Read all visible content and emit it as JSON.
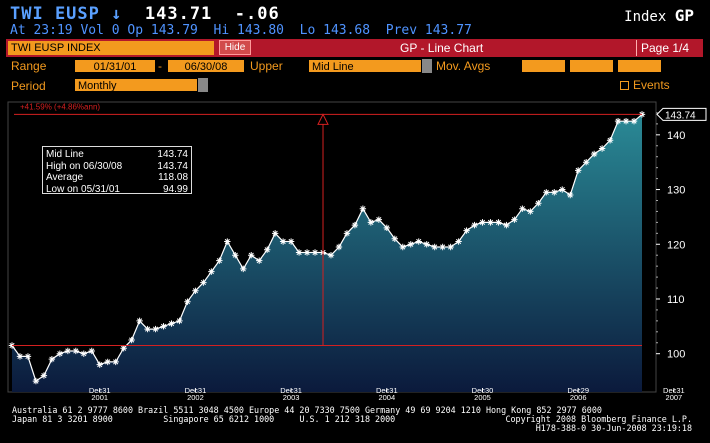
{
  "header": {
    "ticker": "TWI EUSP",
    "arrow": "↓",
    "price": "143.71",
    "change": "-.06",
    "market": "Index",
    "function": "GP",
    "at": "At 23:19",
    "vol": "Vol 0",
    "op": "Op 143.79",
    "hi": "Hi 143.80",
    "lo": "Lo 143.68",
    "prev": "Prev 143.77"
  },
  "toolbar": {
    "security": "TWI EUSP INDEX",
    "hide_label": "Hide",
    "title": "GP - Line Chart",
    "page": "Page 1/4"
  },
  "controls": {
    "range_label": "Range",
    "start_date": "01/31/01",
    "dash": "-",
    "end_date": "06/30/08",
    "upper_label": "Upper",
    "upper_value": "Mid Line",
    "mov_avgs_label": "Mov. Avgs",
    "period_label": "Period",
    "period_value": "Monthly",
    "events_label": "Events"
  },
  "chart_data": {
    "type": "area",
    "series": [
      {
        "name": "Mid Line",
        "values": [
          101.5,
          99.5,
          99.5,
          94.99,
          96,
          99,
          100,
          100.5,
          100.5,
          100,
          100.5,
          98,
          98.5,
          98.5,
          101,
          102.5,
          106,
          104.5,
          104.5,
          105,
          105.5,
          106,
          109.5,
          111.5,
          113,
          115,
          117,
          120.5,
          118,
          115.5,
          118,
          117,
          119,
          122,
          120.5,
          120.5,
          118.5,
          118.5,
          118.5,
          118.5,
          118,
          119.5,
          122,
          123.5,
          126.5,
          124,
          124.5,
          123,
          121,
          119.5,
          120,
          120.5,
          120,
          119.5,
          119.5,
          119.5,
          120.5,
          122.5,
          123.5,
          124,
          124,
          124,
          123.5,
          124.5,
          126.5,
          126,
          127.5,
          129.5,
          129.5,
          130,
          129,
          133.5,
          135,
          136.5,
          137.5,
          139,
          142.5,
          142.5,
          142.5,
          143.74
        ]
      }
    ],
    "x_ticks": [
      {
        "date": "Dec31",
        "year": "2001",
        "i": 11
      },
      {
        "date": "Dec31",
        "year": "2002",
        "i": 23
      },
      {
        "date": "Dec31",
        "year": "2003",
        "i": 35
      },
      {
        "date": "Dec31",
        "year": "2004",
        "i": 47
      },
      {
        "date": "Dec30",
        "year": "2005",
        "i": 59
      },
      {
        "date": "Dec29",
        "year": "2006",
        "i": 71
      },
      {
        "date": "Dec31",
        "year": "2007",
        "i": 83
      }
    ],
    "y_ticks": [
      100,
      110,
      120,
      130,
      140
    ],
    "ylim": [
      93,
      146
    ],
    "last_value_label": "143.74",
    "low_line": 101.5,
    "high_line": 143.74,
    "change_label": "+41.59% (+4.86%ann)",
    "legend": [
      {
        "label": "Mid Line",
        "value": "143.74"
      },
      {
        "label": "High on 06/30/08",
        "value": "143.74"
      },
      {
        "label": "Average",
        "value": "118.08"
      },
      {
        "label": "Low on 05/31/01",
        "value": "94.99"
      }
    ]
  },
  "footer": {
    "line1": "Australia 61 2 9777 8600 Brazil 5511 3048 4500 Europe 44 20 7330 7500 Germany 49 69 9204 1210 Hong Kong 852 2977 6000",
    "line2_left": "Japan 81 3 3201 8900",
    "line2_mid": "Singapore 65 6212 1000",
    "line2_mid2": "U.S. 1 212 318 2000",
    "line2_right": "Copyright 2008 Bloomberg Finance L.P.",
    "line3": "H178-388-0 30-Jun-2008 23:19:18"
  },
  "colors": {
    "accent": "#f39a1e",
    "redbar": "#b2172a",
    "header_blue": "#4f93ff",
    "area_top": "#2a8a96",
    "area_bottom": "#0b1a3c",
    "ref_line": "#d42020"
  }
}
